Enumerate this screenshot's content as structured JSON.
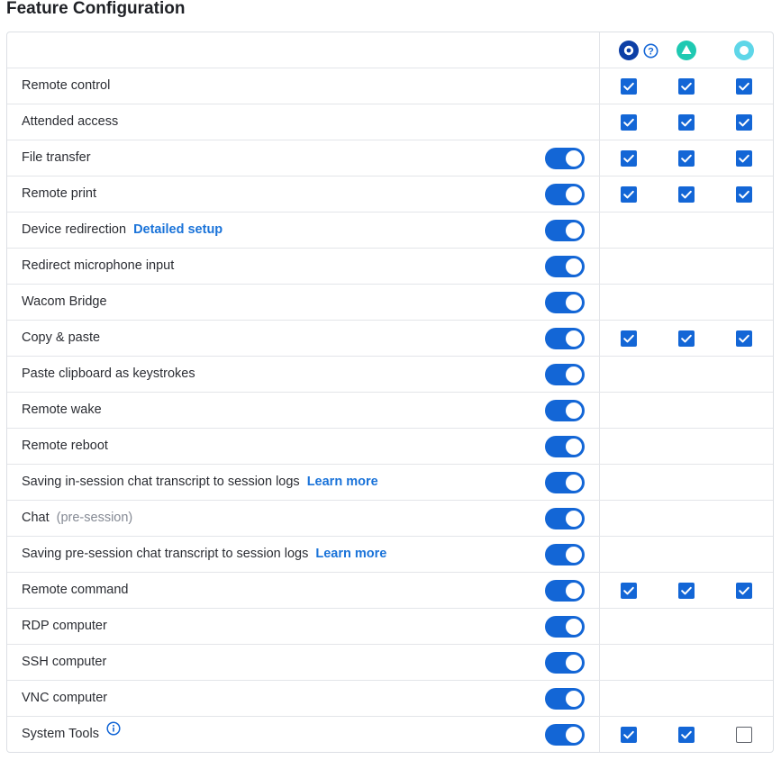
{
  "title": "Feature Configuration",
  "header": {
    "icons": [
      "windows-platform-icon",
      "help-icon",
      "triangle-platform-icon",
      "circle-platform-icon"
    ],
    "colors": {
      "platform1": "#0d3fa6",
      "platform2": "#1fc9b2",
      "platform3": "#5ed6e8",
      "accent": "#1366d6"
    }
  },
  "rows": [
    {
      "label": "Remote control",
      "toggle": null,
      "checks": [
        true,
        true,
        true
      ]
    },
    {
      "label": "Attended access",
      "toggle": null,
      "checks": [
        true,
        true,
        true
      ]
    },
    {
      "label": "File transfer",
      "toggle": true,
      "checks": [
        true,
        true,
        true
      ]
    },
    {
      "label": "Remote print",
      "toggle": true,
      "checks": [
        true,
        true,
        true
      ]
    },
    {
      "label": "Device redirection",
      "link": "Detailed setup",
      "toggle": true,
      "checks": null
    },
    {
      "label": "Redirect microphone input",
      "toggle": true,
      "checks": null
    },
    {
      "label": "Wacom Bridge",
      "toggle": true,
      "checks": null
    },
    {
      "label": "Copy & paste",
      "toggle": true,
      "checks": [
        true,
        true,
        true
      ]
    },
    {
      "label": "Paste clipboard as keystrokes",
      "toggle": true,
      "checks": null
    },
    {
      "label": "Remote wake",
      "toggle": true,
      "checks": null
    },
    {
      "label": "Remote reboot",
      "toggle": true,
      "checks": null
    },
    {
      "label": "Saving in-session chat transcript to session logs",
      "link": "Learn more",
      "toggle": true,
      "checks": null
    },
    {
      "label": "Chat",
      "note": "(pre-session)",
      "toggle": true,
      "checks": null
    },
    {
      "label": "Saving pre-session chat transcript to session logs",
      "link": "Learn more",
      "toggle": true,
      "checks": null
    },
    {
      "label": "Remote command",
      "toggle": true,
      "checks": [
        true,
        true,
        true
      ]
    },
    {
      "label": "RDP computer",
      "toggle": true,
      "checks": null
    },
    {
      "label": "SSH computer",
      "toggle": true,
      "checks": null
    },
    {
      "label": "VNC computer",
      "toggle": true,
      "checks": null
    },
    {
      "label": "System Tools",
      "info": "info-icon",
      "toggle": true,
      "checks": [
        true,
        true,
        false
      ]
    }
  ]
}
